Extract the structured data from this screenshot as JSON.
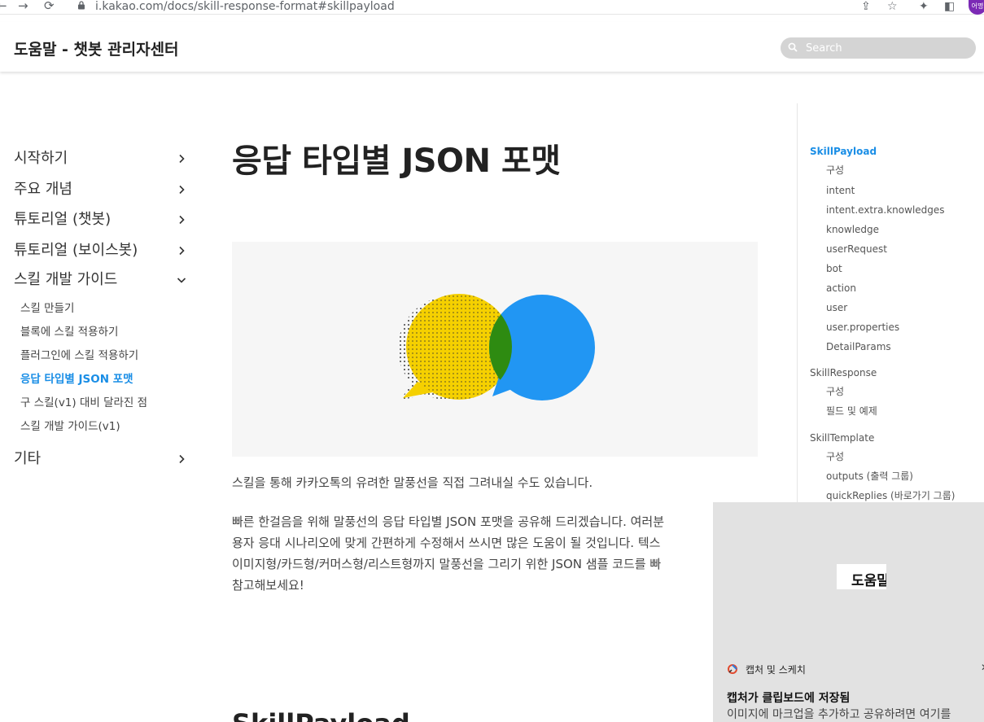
{
  "browser": {
    "url": "i.kakao.com/docs/skill-response-format#skillpayload",
    "profile_label": "어명"
  },
  "header": {
    "title": "도움말 - 챗봇 관리자센터",
    "search_placeholder": "Search"
  },
  "sidebar": {
    "items": [
      {
        "label": "시작하기"
      },
      {
        "label": "주요 개념"
      },
      {
        "label": "튜토리얼 (챗봇)"
      },
      {
        "label": "튜토리얼 (보이스봇)"
      },
      {
        "label": "스킬 개발 가이드"
      },
      {
        "label": "기타"
      }
    ],
    "sub_items": [
      {
        "label": "스킬 만들기"
      },
      {
        "label": "블록에 스킬 적용하기"
      },
      {
        "label": "플러그인에 스킬 적용하기"
      },
      {
        "label": "응답 타입별 JSON 포맷"
      },
      {
        "label": "구 스킬(v1) 대비 달라진 점"
      },
      {
        "label": "스킬 개발 가이드(v1)"
      }
    ]
  },
  "main": {
    "title": "응답 타입별 JSON 포맷",
    "paragraph1": "스킬을 통해 카카오톡의 유려한 말풍선을 직접 그려내실 수도 있습니다.",
    "paragraph2_lines": [
      "빠른 한걸음을 위해 말풍선의 응답 타입별 JSON 포맷을 공유해 드리겠습니다. 여러분",
      "용자 응대 시나리오에 맞게 간편하게 수정해서 쓰시면 많은 도움이 될 것입니다. 텍스",
      "이미지형/카드형/커머스형/리스트형까지 말풍선을 그리기 위한 JSON 샘플 코드를 빠",
      "참고해보세요!"
    ],
    "bottom_heading": "SkillPayload"
  },
  "toc": [
    {
      "label": "SkillPayload",
      "active": true
    },
    {
      "label": "구성"
    },
    {
      "label": "intent"
    },
    {
      "label": "intent.extra.knowledges"
    },
    {
      "label": "knowledge"
    },
    {
      "label": "userRequest"
    },
    {
      "label": "bot"
    },
    {
      "label": "action"
    },
    {
      "label": "user"
    },
    {
      "label": "user.properties"
    },
    {
      "label": "DetailParams"
    },
    {
      "label": "SkillResponse"
    },
    {
      "label": "구성"
    },
    {
      "label": "필드 및 예제"
    },
    {
      "label": "SkillTemplate"
    },
    {
      "label": "구성"
    },
    {
      "label": "outputs (출력 그룹)"
    },
    {
      "label": "quickReplies (바로가기 그룹)"
    }
  ],
  "toast": {
    "preview_text": "도움말",
    "app_name": "캡처 및 스케치",
    "title": "캡처가 클립보드에 저장됨",
    "body": "이미지에 마크업을 추가하고 공유하려면 여기를"
  },
  "colors": {
    "accent": "#1a8ee6",
    "bubble_yellow": "#f5d000",
    "bubble_blue": "#2196f3",
    "bubble_overlap": "#2e8b11"
  }
}
